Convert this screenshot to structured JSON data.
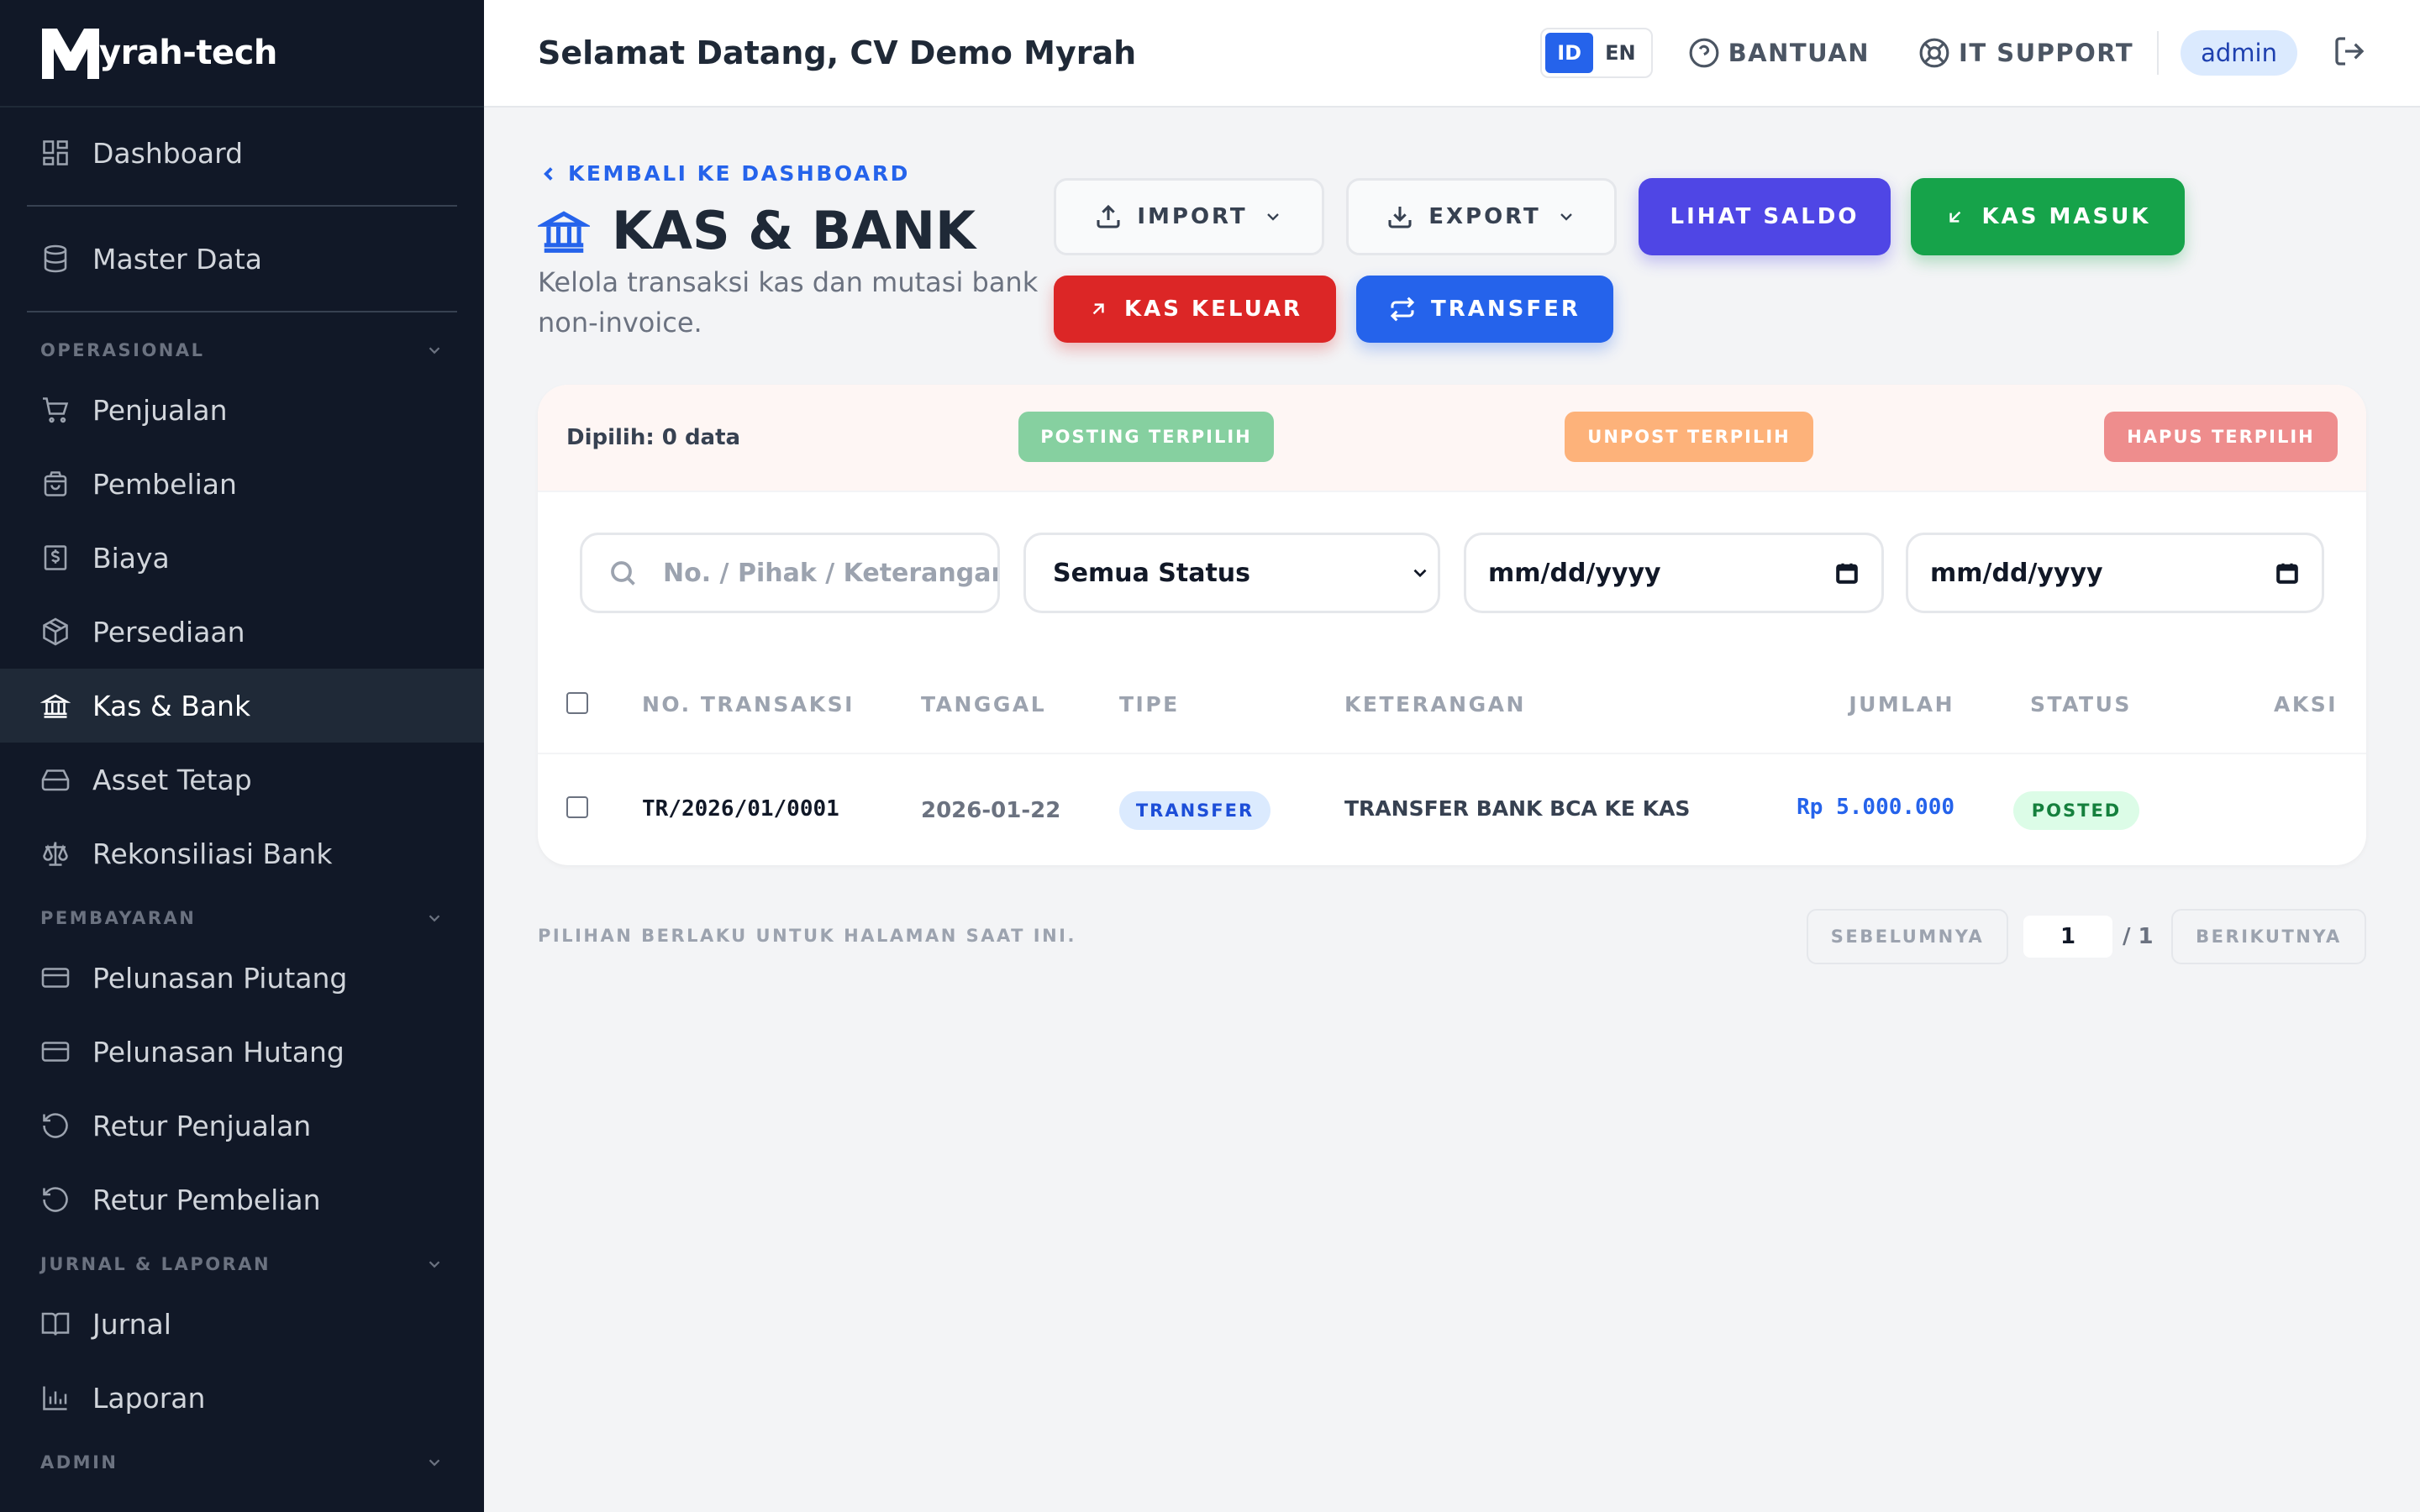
{
  "brand": {
    "name": "yrah-tech",
    "logo_letter": "M"
  },
  "sidebar": {
    "top_items": [
      {
        "label": "Dashboard",
        "icon": "grid-icon"
      },
      {
        "label": "Master Data",
        "icon": "database-icon"
      }
    ],
    "sections": {
      "operasional": "OPERASIONAL",
      "pembayaran": "PEMBAYARAN",
      "jurnal": "JURNAL & LAPORAN",
      "admin": "ADMIN"
    },
    "operasional_items": [
      {
        "label": "Penjualan",
        "icon": "cart-icon"
      },
      {
        "label": "Pembelian",
        "icon": "bag-icon"
      },
      {
        "label": "Biaya",
        "icon": "receipt-icon"
      },
      {
        "label": "Persediaan",
        "icon": "box-icon"
      },
      {
        "label": "Kas & Bank",
        "icon": "bank-icon",
        "active": true
      },
      {
        "label": "Asset Tetap",
        "icon": "harddrive-icon"
      },
      {
        "label": "Rekonsiliasi Bank",
        "icon": "scale-icon"
      }
    ],
    "pembayaran_items": [
      {
        "label": "Pelunasan Piutang",
        "icon": "card-icon"
      },
      {
        "label": "Pelunasan Hutang",
        "icon": "card-icon"
      },
      {
        "label": "Retur Penjualan",
        "icon": "undo-icon"
      },
      {
        "label": "Retur Pembelian",
        "icon": "undo-icon"
      }
    ],
    "jurnal_items": [
      {
        "label": "Jurnal",
        "icon": "book-icon"
      },
      {
        "label": "Laporan",
        "icon": "bar-chart-icon"
      }
    ]
  },
  "topbar": {
    "welcome": "Selamat Datang, CV Demo Myrah",
    "lang_id": "ID",
    "lang_en": "EN",
    "help": "BANTUAN",
    "support": "IT SUPPORT",
    "user": "admin"
  },
  "page": {
    "back": "KEMBALI KE DASHBOARD",
    "title": "KAS & BANK",
    "subtitle": "Kelola transaksi kas dan mutasi bank non-invoice."
  },
  "actions": {
    "import": "IMPORT",
    "export": "EXPORT",
    "lihat_saldo": "LIHAT SALDO",
    "kas_masuk": "KAS MASUK",
    "kas_keluar": "KAS KELUAR",
    "transfer": "TRANSFER"
  },
  "colors": {
    "primary": "#2563eb",
    "indigo": "#4f46e5",
    "green": "#16a34a",
    "red": "#dc2626",
    "sidebar_bg": "#111827"
  },
  "bulk": {
    "selected": "Dipilih: 0 data",
    "posting": "POSTING TERPILIH",
    "unpost": "UNPOST TERPILIH",
    "hapus": "HAPUS TERPILIH"
  },
  "filters": {
    "search_placeholder": "No. / Pihak / Keterangan",
    "status": "Semua Status",
    "date_from": "mm/dd/yyyy",
    "date_to": "mm/dd/yyyy"
  },
  "table": {
    "headers": {
      "no": "NO. TRANSAKSI",
      "tanggal": "TANGGAL",
      "tipe": "TIPE",
      "keterangan": "KETERANGAN",
      "jumlah": "JUMLAH",
      "status": "STATUS",
      "aksi": "AKSI"
    },
    "rows": [
      {
        "no": "TR/2026/01/0001",
        "tanggal": "2026-01-22",
        "tipe": "TRANSFER",
        "keterangan": "TRANSFER BANK BCA KE KAS",
        "jumlah": "Rp 5.000.000",
        "status": "POSTED"
      }
    ]
  },
  "pagination": {
    "note": "PILIHAN BERLAKU UNTUK HALAMAN SAAT INI.",
    "prev": "SEBELUMNYA",
    "page": "1",
    "total": "/ 1",
    "next": "BERIKUTNYA"
  }
}
